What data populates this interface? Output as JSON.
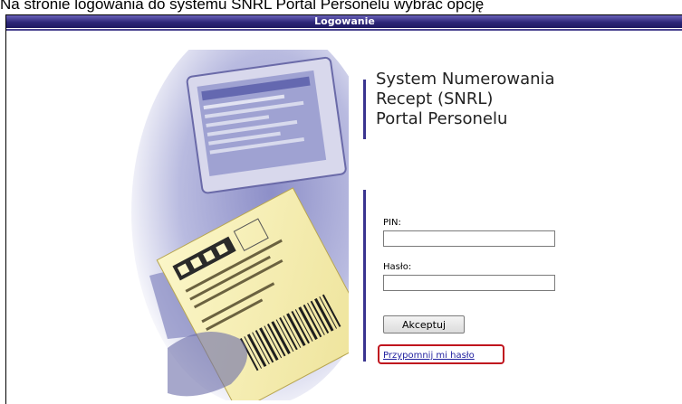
{
  "caption": "Na stronie logowania do systemu SNRL Portal Personelu wybrać opcję",
  "window": {
    "title": "Logowanie"
  },
  "heading": {
    "line1": "System Numerowania",
    "line2": "Recept (SNRL)",
    "line3": "Portal Personelu"
  },
  "form": {
    "pin_label": "PIN:",
    "pin_value": "",
    "password_label": "Hasło:",
    "password_value": "",
    "submit_label": "Akceptuj",
    "remind_link": "Przypomnij mi hasło"
  },
  "colors": {
    "title_bar": "#2c2678",
    "accent_bar": "#3a3490",
    "highlight": "#c0141e",
    "link": "#1f1f9f"
  }
}
